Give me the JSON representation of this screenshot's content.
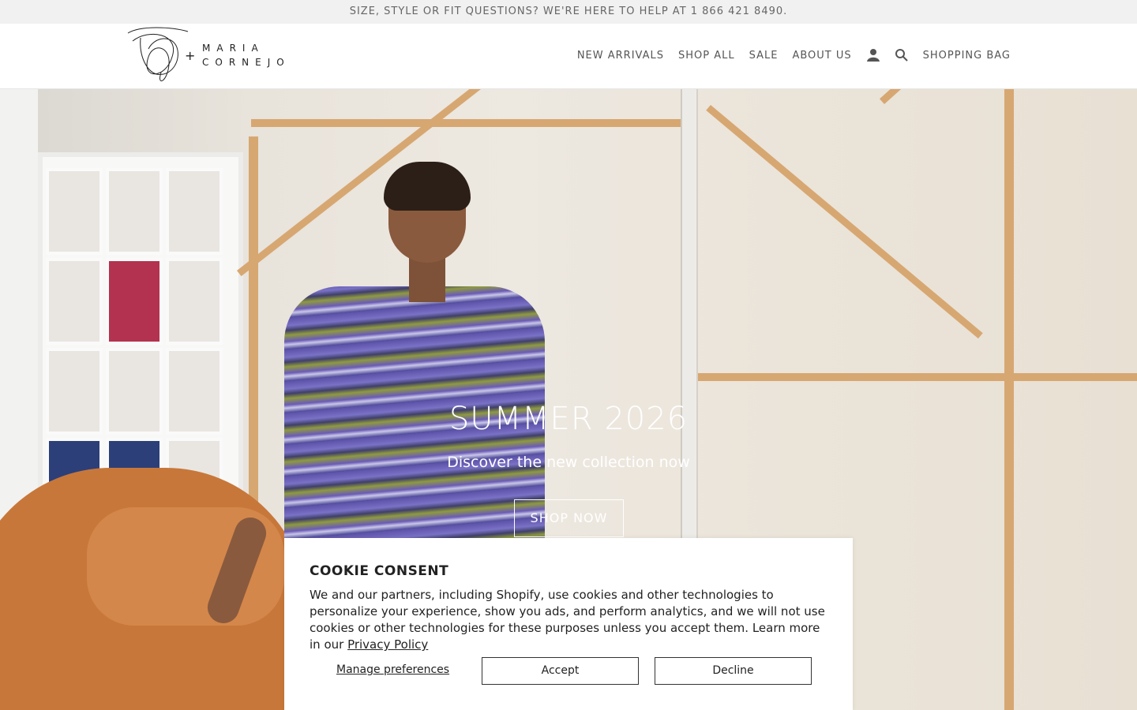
{
  "announcement": "SIZE, STYLE OR FIT QUESTIONS? WE'RE HERE TO HELP AT 1 866 421 8490.",
  "brand": {
    "plus": "+",
    "line1": "MARIA",
    "line2": "CORNEJO"
  },
  "nav": {
    "items": [
      "NEW ARRIVALS",
      "SHOP ALL",
      "SALE",
      "ABOUT US"
    ],
    "account_icon": "user-icon",
    "search_icon": "search-icon",
    "bag": "SHOPPING BAG"
  },
  "hero": {
    "title": "SUMMER 2026",
    "subtitle": "Discover the new collection now",
    "cta": "SHOP NOW"
  },
  "cookie": {
    "title": "COOKIE CONSENT",
    "body": "We and our partners, including Shopify, use cookies and other technologies to personalize your experience, show you ads, and perform analytics, and we will not use cookies or other technologies for these purposes unless you accept them. Learn more in our ",
    "policy_link": "Privacy Policy",
    "manage": "Manage preferences",
    "accept": "Accept",
    "decline": "Decline"
  }
}
